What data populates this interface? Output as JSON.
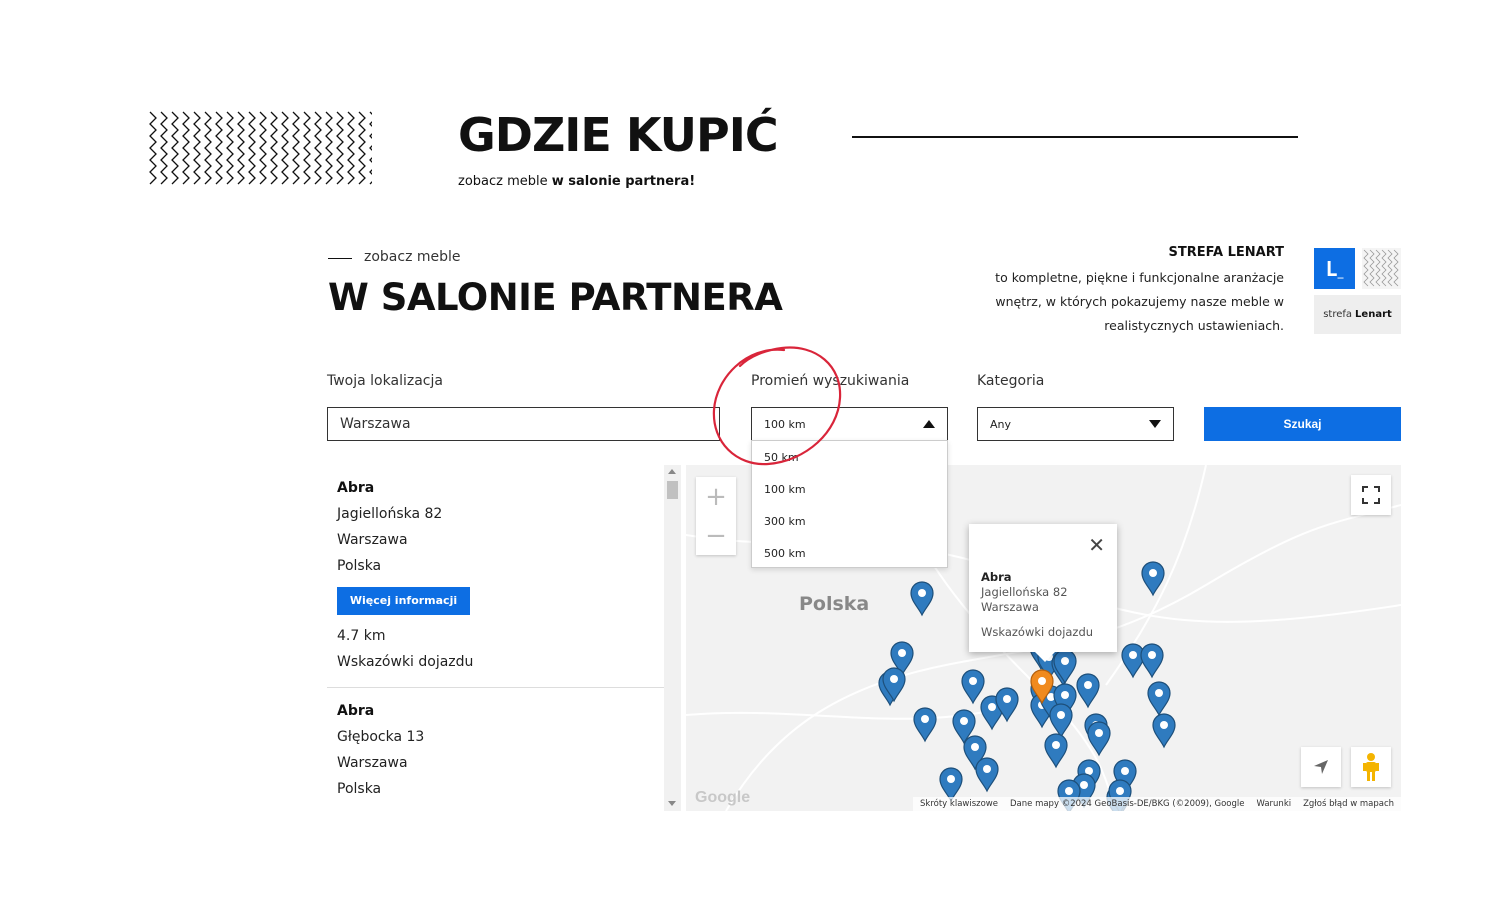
{
  "hero": {
    "title": "GDZIE KUPIĆ",
    "subtitle_prefix": "zobacz meble ",
    "subtitle_bold": "w salonie partnera!"
  },
  "section": {
    "eyebrow": "zobacz meble",
    "title": "W SALONIE PARTNERA"
  },
  "strefa": {
    "title": "STREFA LENART",
    "description": "to kompletne, piękne i funkcjonalne aranżacje wnętrz, w których pokazujemy nasze meble w realistycznych ustawieniach.",
    "logo_mark": "L",
    "logo_text_light": "strefa",
    "logo_text_bold": "Lenart"
  },
  "form": {
    "location_label": "Twoja lokalizacja",
    "location_value": "Warszawa",
    "radius_label": "Promień wyszukiwania",
    "radius_value": "100 km",
    "radius_options": [
      "50 km",
      "100 km",
      "300 km",
      "500 km"
    ],
    "category_label": "Kategoria",
    "category_value": "Any",
    "search_button": "Szukaj"
  },
  "results": [
    {
      "name": "Abra",
      "street": "Jagiellońska 82",
      "city": "Warszawa",
      "country": "Polska",
      "more_button": "Więcej informacji",
      "distance": "4.7 km",
      "directions": "Wskazówki dojazdu"
    },
    {
      "name": "Abra",
      "street": "Głębocka 13",
      "city": "Warszawa",
      "country": "Polska"
    }
  ],
  "map": {
    "country_label": "Polska",
    "zoom_in": "+",
    "zoom_out": "−",
    "google_logo": "Google",
    "attribution": [
      "Skróty klawiszowe",
      "Dane mapy ©2024 GeoBasis-DE/BKG (©2009), Google",
      "Warunki",
      "Zgłoś błąd w mapach"
    ],
    "pin_color": "#2f7bbf",
    "active_pin_color": "#f08a1e",
    "info_window": {
      "name": "Abra",
      "street": "Jagiellońska 82",
      "city": "Warszawa",
      "directions": "Wskazówki dojazdu"
    }
  },
  "colors": {
    "accent": "#0d6ee3",
    "annotation": "#d9253a"
  }
}
